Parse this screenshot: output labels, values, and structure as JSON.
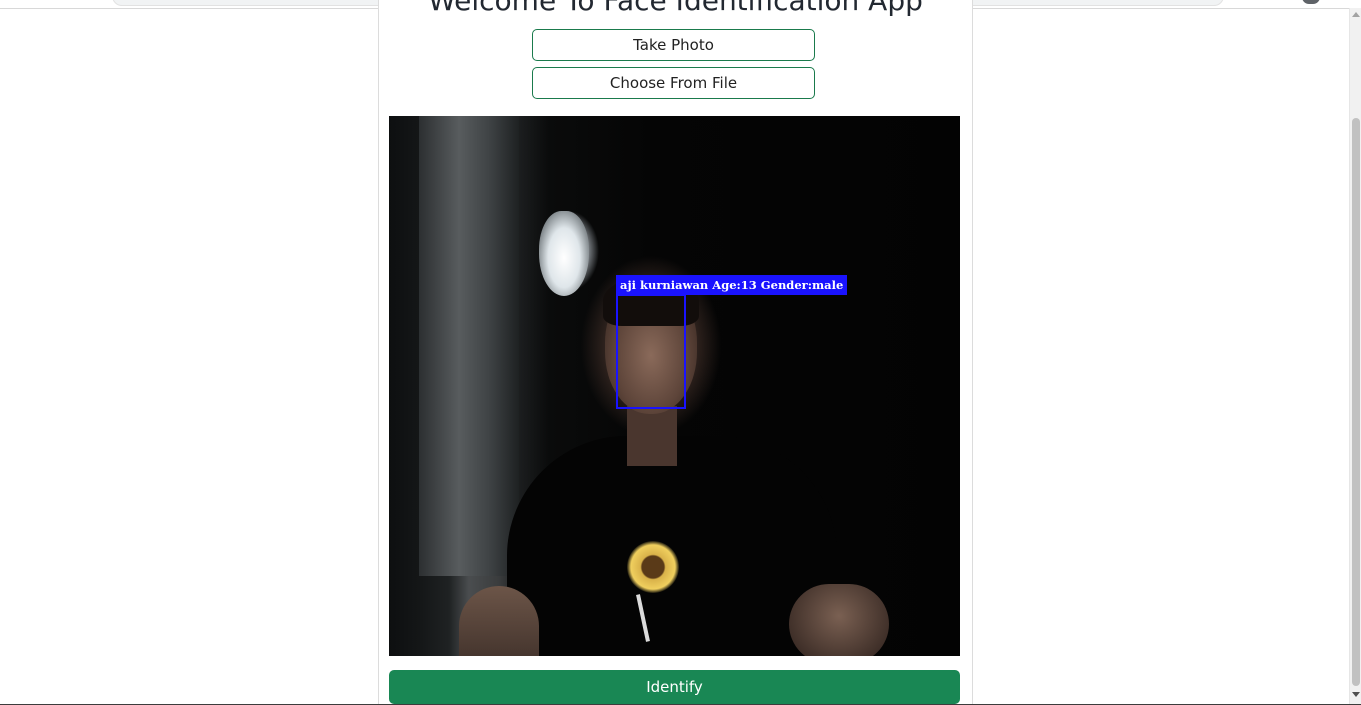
{
  "app": {
    "title": "Welcome To Face Identification App"
  },
  "actions": {
    "take_photo_label": "Take Photo",
    "choose_file_label": "Choose From File",
    "identify_label": "Identify"
  },
  "detection": {
    "label": "aji kurniawan Age:13 Gender:male",
    "box_color": "#1a13ff"
  },
  "colors": {
    "accent": "#198754",
    "outline": "#1a7a4c"
  }
}
